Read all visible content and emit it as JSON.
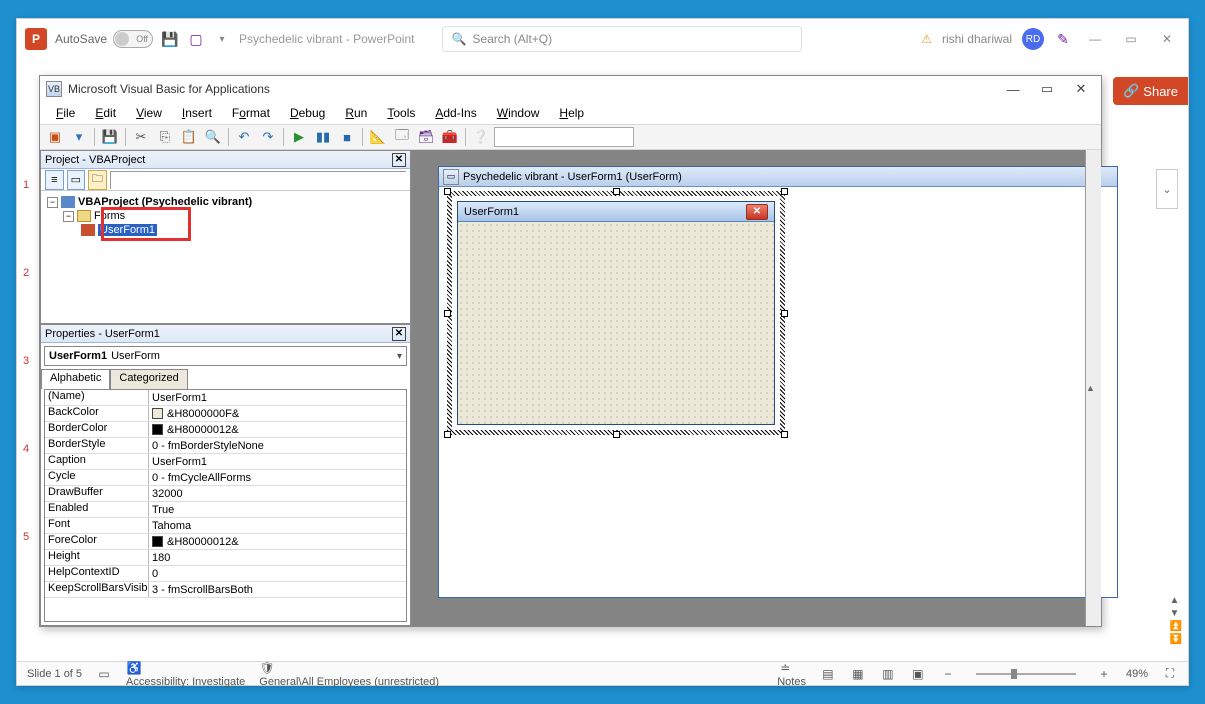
{
  "pp": {
    "logo": "P",
    "autosave": "AutoSave",
    "autosave_state": "Off",
    "doc_title": "Psychedelic vibrant - PowerPoint",
    "search_placeholder": "Search (Alt+Q)",
    "user_name": "rishi dhariwal",
    "user_initials": "RD",
    "share": "Share",
    "status_slide": "Slide 1 of 5",
    "status_access": "Accessibility: Investigate",
    "status_sens": "General\\All Employees (unrestricted)",
    "status_notes": "Notes",
    "zoom": "49%"
  },
  "slides": {
    "n1": "1",
    "n2": "2",
    "n3": "3",
    "n4": "4",
    "n5": "5"
  },
  "vba": {
    "title": "Microsoft Visual Basic for Applications",
    "menu": {
      "file": "File",
      "edit": "Edit",
      "view": "View",
      "insert": "Insert",
      "format": "Format",
      "debug": "Debug",
      "run": "Run",
      "tools": "Tools",
      "addins": "Add-Ins",
      "window": "Window",
      "help": "Help"
    },
    "project": {
      "title": "Project - VBAProject",
      "root": "VBAProject (Psychedelic vibrant)",
      "forms": "Forms",
      "form1": "UserForm1"
    },
    "props": {
      "title": "Properties - UserForm1",
      "object_bold": "UserForm1",
      "object_type": "UserForm",
      "tab_alpha": "Alphabetic",
      "tab_cat": "Categorized",
      "rows": [
        {
          "k": "(Name)",
          "v": "UserForm1"
        },
        {
          "k": "BackColor",
          "v": "&H8000000F&",
          "swatch": "#ece9d8"
        },
        {
          "k": "BorderColor",
          "v": "&H80000012&",
          "swatch": "#000000"
        },
        {
          "k": "BorderStyle",
          "v": "0 - fmBorderStyleNone"
        },
        {
          "k": "Caption",
          "v": "UserForm1"
        },
        {
          "k": "Cycle",
          "v": "0 - fmCycleAllForms"
        },
        {
          "k": "DrawBuffer",
          "v": "32000"
        },
        {
          "k": "Enabled",
          "v": "True"
        },
        {
          "k": "Font",
          "v": "Tahoma"
        },
        {
          "k": "ForeColor",
          "v": "&H80000012&",
          "swatch": "#000000"
        },
        {
          "k": "Height",
          "v": "180"
        },
        {
          "k": "HelpContextID",
          "v": "0"
        },
        {
          "k": "KeepScrollBarsVisible",
          "v": "3 - fmScrollBarsBoth"
        }
      ]
    },
    "designer": {
      "mdi_title": "Psychedelic vibrant - UserForm1 (UserForm)",
      "form_caption": "UserForm1"
    }
  }
}
